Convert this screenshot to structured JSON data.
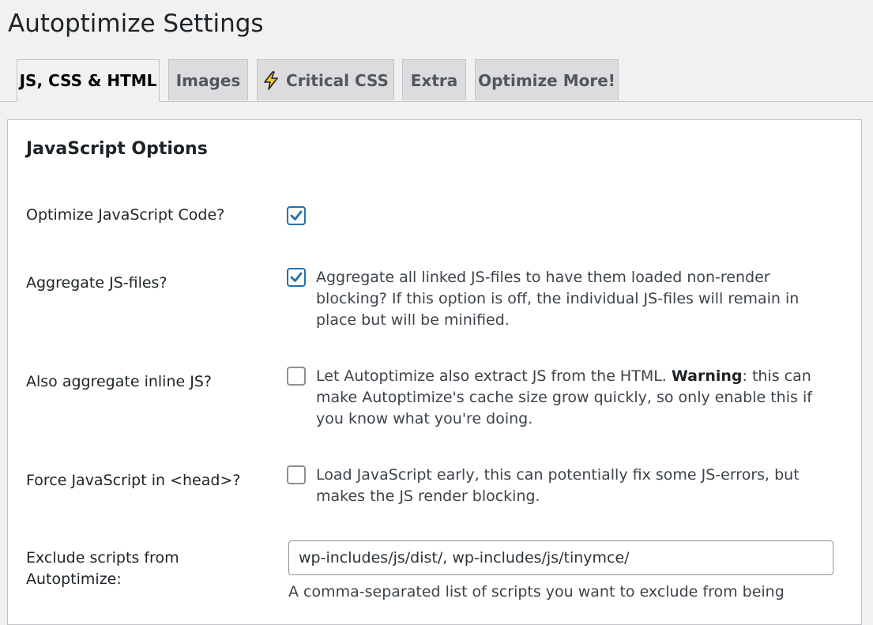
{
  "page": {
    "title": "Autoptimize Settings"
  },
  "tabs": [
    {
      "label": "JS, CSS & HTML",
      "active": true
    },
    {
      "label": "Images",
      "active": false
    },
    {
      "label": "Critical CSS",
      "active": false,
      "icon": "lightning-bolt-icon"
    },
    {
      "label": "Extra",
      "active": false
    },
    {
      "label": "Optimize More!",
      "active": false
    }
  ],
  "section": {
    "title": "JavaScript Options"
  },
  "options": {
    "optimize_js": {
      "label": "Optimize JavaScript Code?",
      "checked": true
    },
    "aggregate_js": {
      "label": "Aggregate JS-files?",
      "checked": true,
      "description": "Aggregate all linked JS-files to have them loaded non-render blocking? If this option is off, the individual JS-files will remain in place but will be minified."
    },
    "aggregate_inline_js": {
      "label": "Also aggregate inline JS?",
      "checked": false,
      "description_pre": "Let Autoptimize also extract JS from the HTML. ",
      "description_bold": "Warning",
      "description_post": ": this can make Autoptimize's cache size grow quickly, so only enable this if you know what you're doing."
    },
    "force_js_head": {
      "label": "Force JavaScript in <head>?",
      "checked": false,
      "description": "Load JavaScript early, this can potentially fix some JS-errors, but makes the JS render blocking."
    },
    "exclude_scripts": {
      "label": "Exclude scripts from Autoptimize:",
      "value": "wp-includes/js/dist/, wp-includes/js/tinymce/",
      "hint": "A comma-separated list of scripts you want to exclude from being"
    }
  },
  "colors": {
    "accent": "#2271b1",
    "bolt": "#f0c33c"
  }
}
